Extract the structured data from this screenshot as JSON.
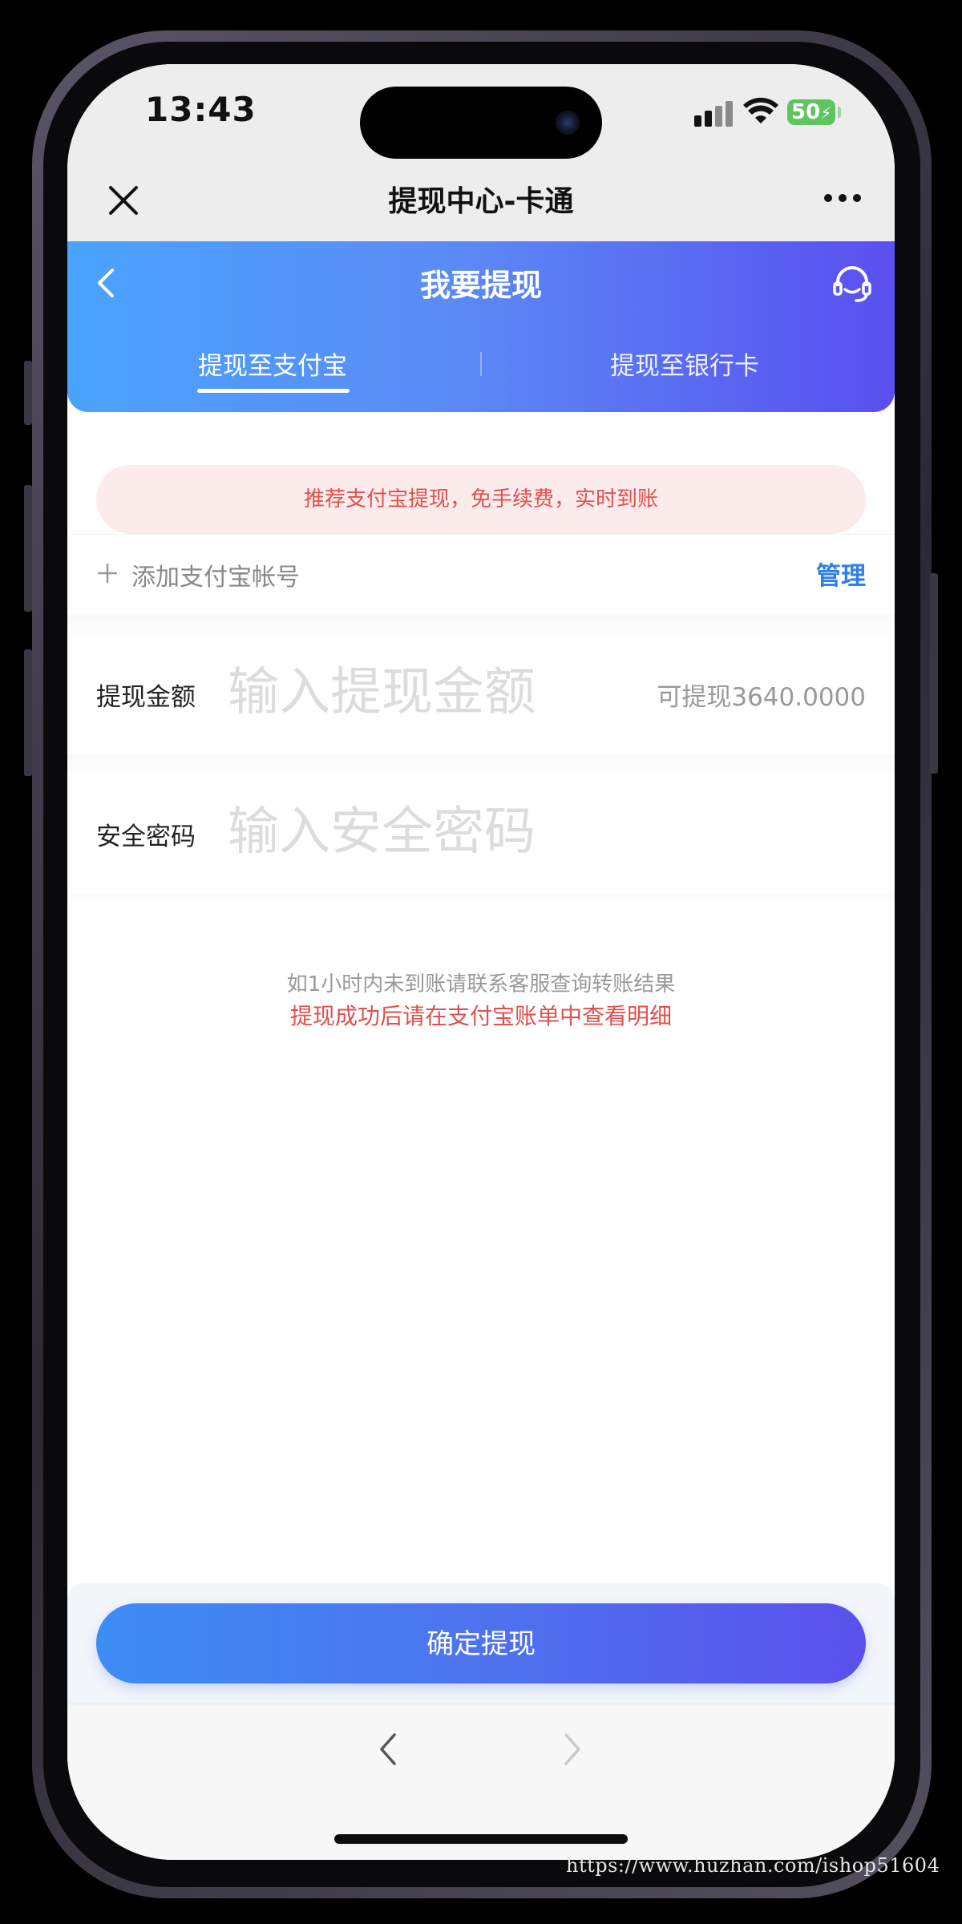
{
  "status_bar": {
    "time": "13:43",
    "battery": "50"
  },
  "mini_program": {
    "title": "提现中心-卡通"
  },
  "header": {
    "title": "我要提现",
    "tabs": [
      {
        "label": "提现至支付宝",
        "active": true
      },
      {
        "label": "提现至银行卡",
        "active": false
      }
    ]
  },
  "notice": "推荐支付宝提现，免手续费，实时到账",
  "account": {
    "add_label": "添加支付宝帐号",
    "manage_label": "管理"
  },
  "amount_field": {
    "label": "提现金额",
    "placeholder": "输入提现金额",
    "available": "可提现3640.0000"
  },
  "password_field": {
    "label": "安全密码",
    "placeholder": "输入安全密码"
  },
  "hints": {
    "line1": "如1小时内未到账请联系客服查询转账结果",
    "line2": "提现成功后请在支付宝账单中查看明细"
  },
  "submit_label": "确定提现",
  "watermark": "https://www.huzhan.com/ishop51604",
  "colors": {
    "accent_blue": "#2f7fe6",
    "alert_red": "#e0504e",
    "header_gradient_start": "#4aa3ff",
    "header_gradient_end": "#5a4ff0"
  },
  "icons": [
    "close-icon",
    "more-icon",
    "back-icon",
    "headset-icon",
    "plus-icon",
    "chevron-left-icon",
    "chevron-right-icon"
  ]
}
